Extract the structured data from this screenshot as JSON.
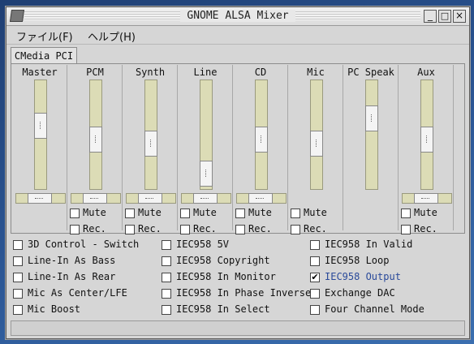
{
  "window": {
    "title": "GNOME ALSA Mixer",
    "minimize": "_",
    "maximize": "□",
    "close": "×"
  },
  "menubar": {
    "file": "ファイル(F)",
    "help": "ヘルプ(H)"
  },
  "tab": {
    "label": "CMedia PCI"
  },
  "channels": [
    {
      "name": "Master",
      "level": 0.62,
      "has_mute": false,
      "has_rec": false,
      "has_balance": true
    },
    {
      "name": "PCM",
      "level": 0.45,
      "has_mute": true,
      "has_rec": true,
      "has_balance": true
    },
    {
      "name": "Synth",
      "level": 0.4,
      "has_mute": true,
      "has_rec": true,
      "has_balance": true
    },
    {
      "name": "Line",
      "level": 0.05,
      "has_mute": true,
      "has_rec": true,
      "has_balance": true
    },
    {
      "name": "CD",
      "level": 0.45,
      "has_mute": true,
      "has_rec": true,
      "has_balance": true
    },
    {
      "name": "Mic",
      "level": 0.4,
      "has_mute": true,
      "has_rec": true,
      "has_balance": false
    },
    {
      "name": "PC Speak",
      "level": 0.7,
      "has_mute": false,
      "has_rec": false,
      "has_balance": false
    },
    {
      "name": "Aux",
      "level": 0.45,
      "has_mute": true,
      "has_rec": true,
      "has_balance": true
    }
  ],
  "labels": {
    "mute": "Mute",
    "rec": "Rec."
  },
  "options": [
    [
      "3D Control - Switch",
      "Line-In As Bass",
      "Line-In As Rear",
      "Mic As Center/LFE",
      "Mic Boost"
    ],
    [
      "IEC958 5V",
      "IEC958 Copyright",
      "IEC958 In Monitor",
      "IEC958 In Phase Inverse",
      "IEC958 In Select"
    ],
    [
      "IEC958 In Valid",
      "IEC958 Loop",
      "IEC958 Output",
      "Exchange DAC",
      "Four Channel Mode"
    ]
  ],
  "checked_option": "IEC958 Output",
  "colors": {
    "slider_track": "#dcdcb6",
    "checked_label": "#2a4a9a"
  }
}
